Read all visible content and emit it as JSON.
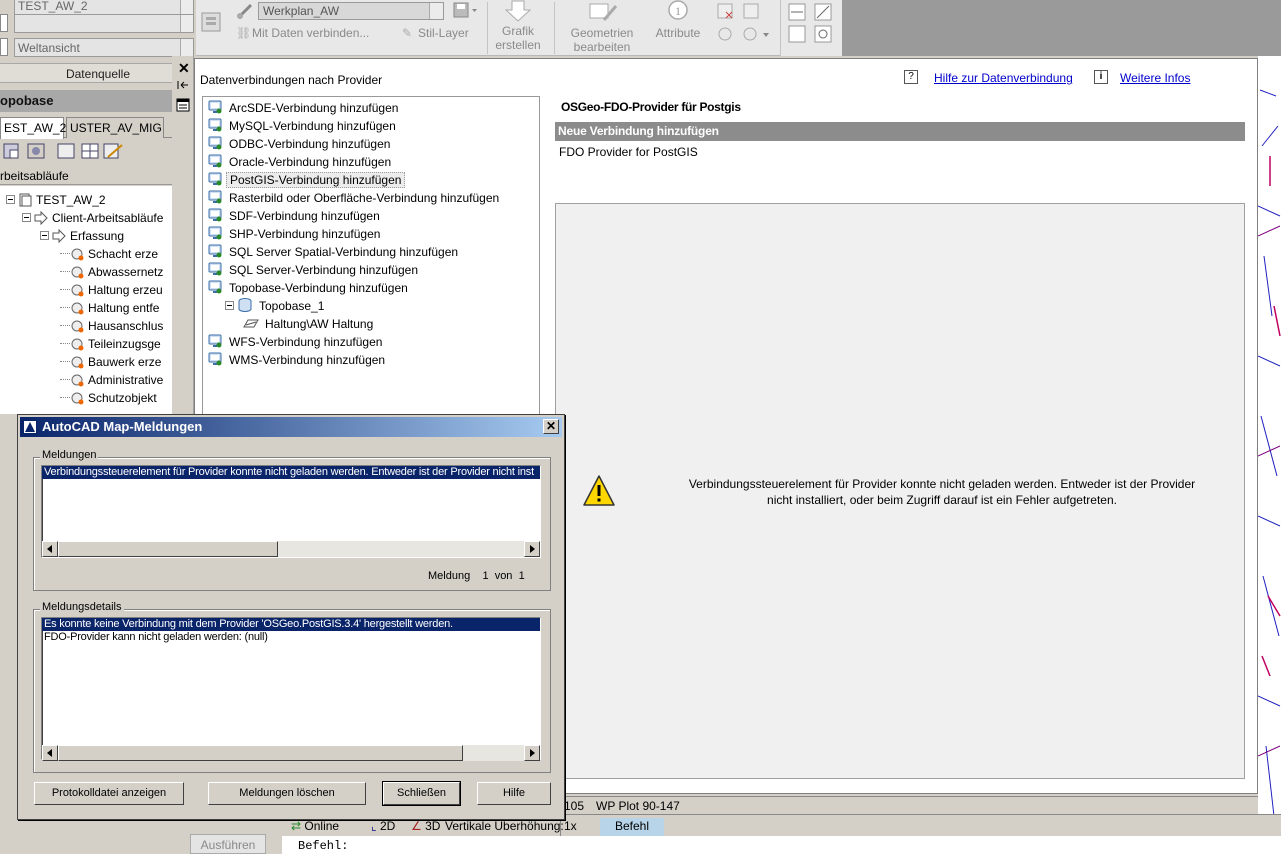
{
  "left_palette": {
    "combo1_value": "TEST_AW_2",
    "combo2_value": "",
    "combo3_value": "Weltansicht",
    "datenquelle_label": "Datenquelle",
    "topobase_title": "opobase",
    "tabs": [
      "EST_AW_2",
      "USTER_AV_MIG"
    ],
    "workspace_label": "rbeitsabläufe",
    "tree": [
      {
        "label": "TEST_AW_2",
        "level": 0
      },
      {
        "label": "Client-Arbeitsabläufe",
        "level": 1
      },
      {
        "label": "Erfassung",
        "level": 2
      },
      {
        "label": "Schacht erze",
        "level": 3
      },
      {
        "label": "Abwassernetz",
        "level": 3
      },
      {
        "label": "Haltung erzeu",
        "level": 3
      },
      {
        "label": "Haltung entfe",
        "level": 3
      },
      {
        "label": "Hausanschlus",
        "level": 3
      },
      {
        "label": "Teileinzugsge",
        "level": 3
      },
      {
        "label": "Bauwerk erze",
        "level": 3
      },
      {
        "label": "Administrative",
        "level": 3
      },
      {
        "label": "Schutzobjekt",
        "level": 3
      }
    ],
    "execute_button": "Ausführen"
  },
  "ribbon": {
    "style_combo_value": "Werkplan_AW",
    "link_data_label": "Mit Daten verbinden...",
    "style_layer_label": "Stil-Layer",
    "create_graphic_label_1": "Grafik",
    "create_graphic_label_2": "erstellen",
    "edit_geometry_label_1": "Geometrien",
    "edit_geometry_label_2": "bearbeiten",
    "attribute_label": "Attribute"
  },
  "data_connect": {
    "title": "Datenverbindungen nach Provider",
    "help_icon_text": "?",
    "help_link": "Hilfe zur Datenverbindung",
    "info_icon_text": "i",
    "more_info_link": "Weitere Infos",
    "providers": [
      {
        "label": "ArcSDE-Verbindung hinzufügen",
        "indent": 0,
        "selected": false
      },
      {
        "label": "MySQL-Verbindung hinzufügen",
        "indent": 0,
        "selected": false
      },
      {
        "label": "ODBC-Verbindung hinzufügen",
        "indent": 0,
        "selected": false
      },
      {
        "label": "Oracle-Verbindung hinzufügen",
        "indent": 0,
        "selected": false
      },
      {
        "label": "PostGIS-Verbindung hinzufügen",
        "indent": 0,
        "selected": true
      },
      {
        "label": "Rasterbild oder Oberfläche-Verbindung hinzufügen",
        "indent": 0,
        "selected": false
      },
      {
        "label": "SDF-Verbindung hinzufügen",
        "indent": 0,
        "selected": false
      },
      {
        "label": "SHP-Verbindung hinzufügen",
        "indent": 0,
        "selected": false
      },
      {
        "label": "SQL Server Spatial-Verbindung hinzufügen",
        "indent": 0,
        "selected": false
      },
      {
        "label": "SQL Server-Verbindung hinzufügen",
        "indent": 0,
        "selected": false
      },
      {
        "label": "Topobase-Verbindung hinzufügen",
        "indent": 0,
        "selected": false
      },
      {
        "label": "Topobase_1",
        "indent": 1,
        "selected": false
      },
      {
        "label": "Haltung\\AW Haltung",
        "indent": 2,
        "selected": false
      },
      {
        "label": "WFS-Verbindung hinzufügen",
        "indent": 0,
        "selected": false
      },
      {
        "label": "WMS-Verbindung hinzufügen",
        "indent": 0,
        "selected": false
      }
    ],
    "provider_heading": "OSGeo-FDO-Provider für Postgis",
    "new_connection_label": "Neue Verbindung hinzufügen",
    "provider_name": "FDO Provider for PostGIS",
    "error_message_line1": "Verbindungssteuerelement für Provider konnte nicht geladen werden. Entweder ist der Provider",
    "error_message_line2": "nicht installiert, oder beim Zugriff darauf ist ein Fehler aufgetreten."
  },
  "layout_tabs": [
    "105",
    "WP Plot 90-147"
  ],
  "status_bar": {
    "online": "Online",
    "mode_2d": "2D",
    "mode_3d": "3D",
    "vertical_exaggeration_label": "Vertikale Überhöhung:",
    "vertical_exaggeration_value": "1x",
    "command_button": "Befehl"
  },
  "command_line": {
    "prompt": "Befehl:"
  },
  "dialog": {
    "title": "AutoCAD Map-Meldungen",
    "close_symbol": "✕",
    "messages_group": "Meldungen",
    "messages": [
      "Verbindungssteuerelement für Provider konnte nicht geladen werden. Entweder ist der Provider nicht inst"
    ],
    "counter_label": "Meldung",
    "counter_current": "1",
    "counter_of": "von",
    "counter_total": "1",
    "details_group": "Meldungsdetails",
    "details": [
      "Es konnte keine Verbindung mit dem Provider 'OSGeo.PostGIS.3.4' hergestellt werden.",
      "FDO-Provider kann nicht geladen werden: (null)"
    ],
    "buttons": {
      "show_log": "Protokolldatei anzeigen",
      "clear": "Meldungen löschen",
      "close": "Schließen",
      "help": "Hilfe"
    }
  },
  "colors": {
    "title_bar": "#0a246a",
    "selection": "#0a246a",
    "link": "#0000cc",
    "new_connection_bar": "#8c8c8c",
    "warning": "#ffd700"
  }
}
